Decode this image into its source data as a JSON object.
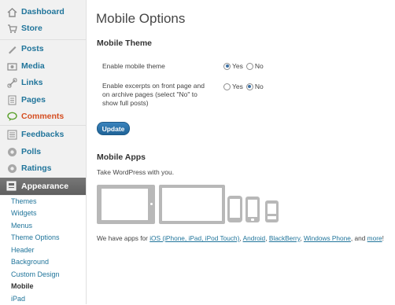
{
  "sidebar": {
    "items": [
      {
        "label": "Dashboard",
        "icon": "dashboard-icon"
      },
      {
        "label": "Store",
        "icon": "store-icon"
      },
      {
        "label": "Posts",
        "icon": "posts-icon"
      },
      {
        "label": "Media",
        "icon": "media-icon"
      },
      {
        "label": "Links",
        "icon": "links-icon"
      },
      {
        "label": "Pages",
        "icon": "pages-icon"
      },
      {
        "label": "Comments",
        "icon": "comments-icon"
      },
      {
        "label": "Feedbacks",
        "icon": "feedbacks-icon"
      },
      {
        "label": "Polls",
        "icon": "polls-icon"
      },
      {
        "label": "Ratings",
        "icon": "ratings-icon"
      }
    ],
    "appearance": {
      "label": "Appearance",
      "icon": "appearance-icon"
    },
    "submenu": [
      "Themes",
      "Widgets",
      "Menus",
      "Theme Options",
      "Header",
      "Background",
      "Custom Design",
      "Mobile",
      "iPad"
    ],
    "current_submenu": "Mobile"
  },
  "main": {
    "title": "Mobile Options",
    "mobile_theme": {
      "heading": "Mobile Theme",
      "enable_label": "Enable mobile theme",
      "enable_value": "Yes",
      "excerpts_label_1": "Enable excerpts on front page and",
      "excerpts_label_2": "on archive pages (select \"No\" to",
      "excerpts_label_3": "show full posts)",
      "excerpts_value": "No",
      "yes": "Yes",
      "no": "No"
    },
    "update_label": "Update",
    "mobile_apps": {
      "heading": "Mobile Apps",
      "subtitle": "Take WordPress with you.",
      "line_prefix": "We have apps for ",
      "ios_link": "iOS (iPhone, iPad, iPod Touch)",
      "sep1": ", ",
      "android_link": "Android",
      "sep2": ", ",
      "blackberry_link": "BlackBerry",
      "sep3": ", ",
      "windows_link": "Windows Phone",
      "sep4": ", and ",
      "more_link": "more",
      "line_suffix": "!"
    }
  },
  "colors": {
    "link": "#21759b",
    "comments": "#d54e21",
    "appearance_bg": "#6d6d6d",
    "button": "#2a74ad",
    "device": "#b8b8b8"
  }
}
